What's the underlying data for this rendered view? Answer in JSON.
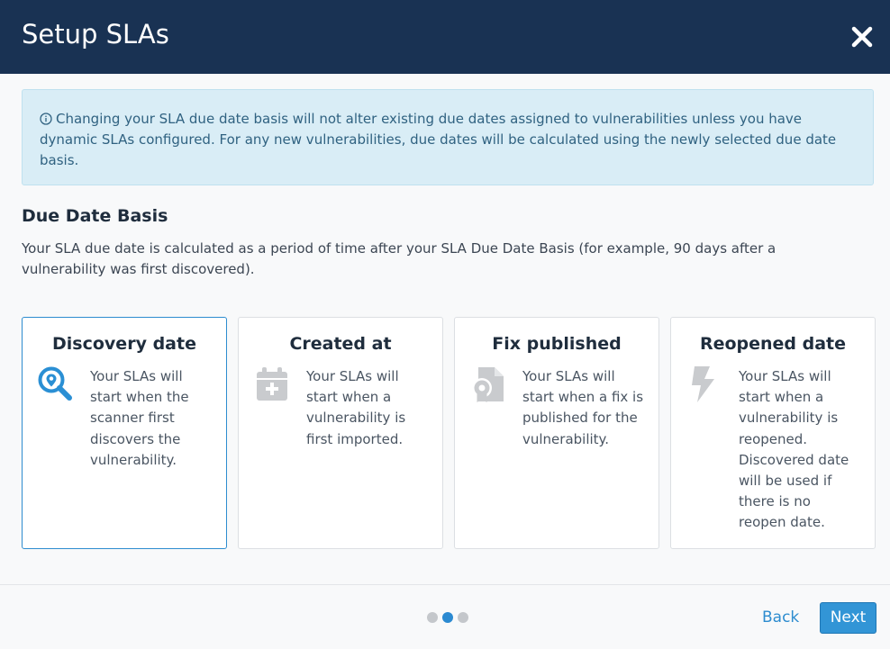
{
  "modal": {
    "title": "Setup SLAs",
    "close_icon": "close-icon"
  },
  "alert": {
    "icon": "info-circle-icon",
    "text": "Changing your SLA due date basis will not alter existing due dates assigned to vulnerabilities unless you have dynamic SLAs configured. For any new vulnerabilities, due dates will be calculated using the newly selected due date basis."
  },
  "section": {
    "title": "Due Date Basis",
    "description": "Your SLA due date is calculated as a period of time after your SLA Due Date Basis (for example, 90 days after a vulnerability was first discovered)."
  },
  "options": [
    {
      "title": "Discovery date",
      "icon": "search-location-icon",
      "lines": [
        "Your SLAs will",
        "start when the",
        "scanner first",
        "discovers the",
        "vulnerability."
      ],
      "selected": true
    },
    {
      "title": "Created at",
      "icon": "calendar-plus-icon",
      "lines": [
        "Your SLAs will",
        "start when a",
        "vulnerability is",
        "first imported."
      ],
      "selected": false
    },
    {
      "title": "Fix published",
      "icon": "file-certificate-icon",
      "lines": [
        "Your SLAs will",
        "start when a fix is",
        "published for the",
        "vulnerability."
      ],
      "selected": false
    },
    {
      "title": "Reopened date",
      "icon": "bolt-icon",
      "lines": [
        "Your SLAs will",
        "start when a",
        "vulnerability is",
        "reopened.",
        "Discovered date",
        "will be used if",
        "there is no",
        "reopen date."
      ],
      "selected": false
    }
  ],
  "pagination": {
    "total_steps": 3,
    "current_step": 2
  },
  "footer": {
    "back_label": "Back",
    "next_label": "Next"
  },
  "colors": {
    "header_bg": "#193253",
    "accent": "#2d8ccf",
    "alert_bg": "#d9edf6",
    "icon_inactive": "#c9cbce"
  }
}
